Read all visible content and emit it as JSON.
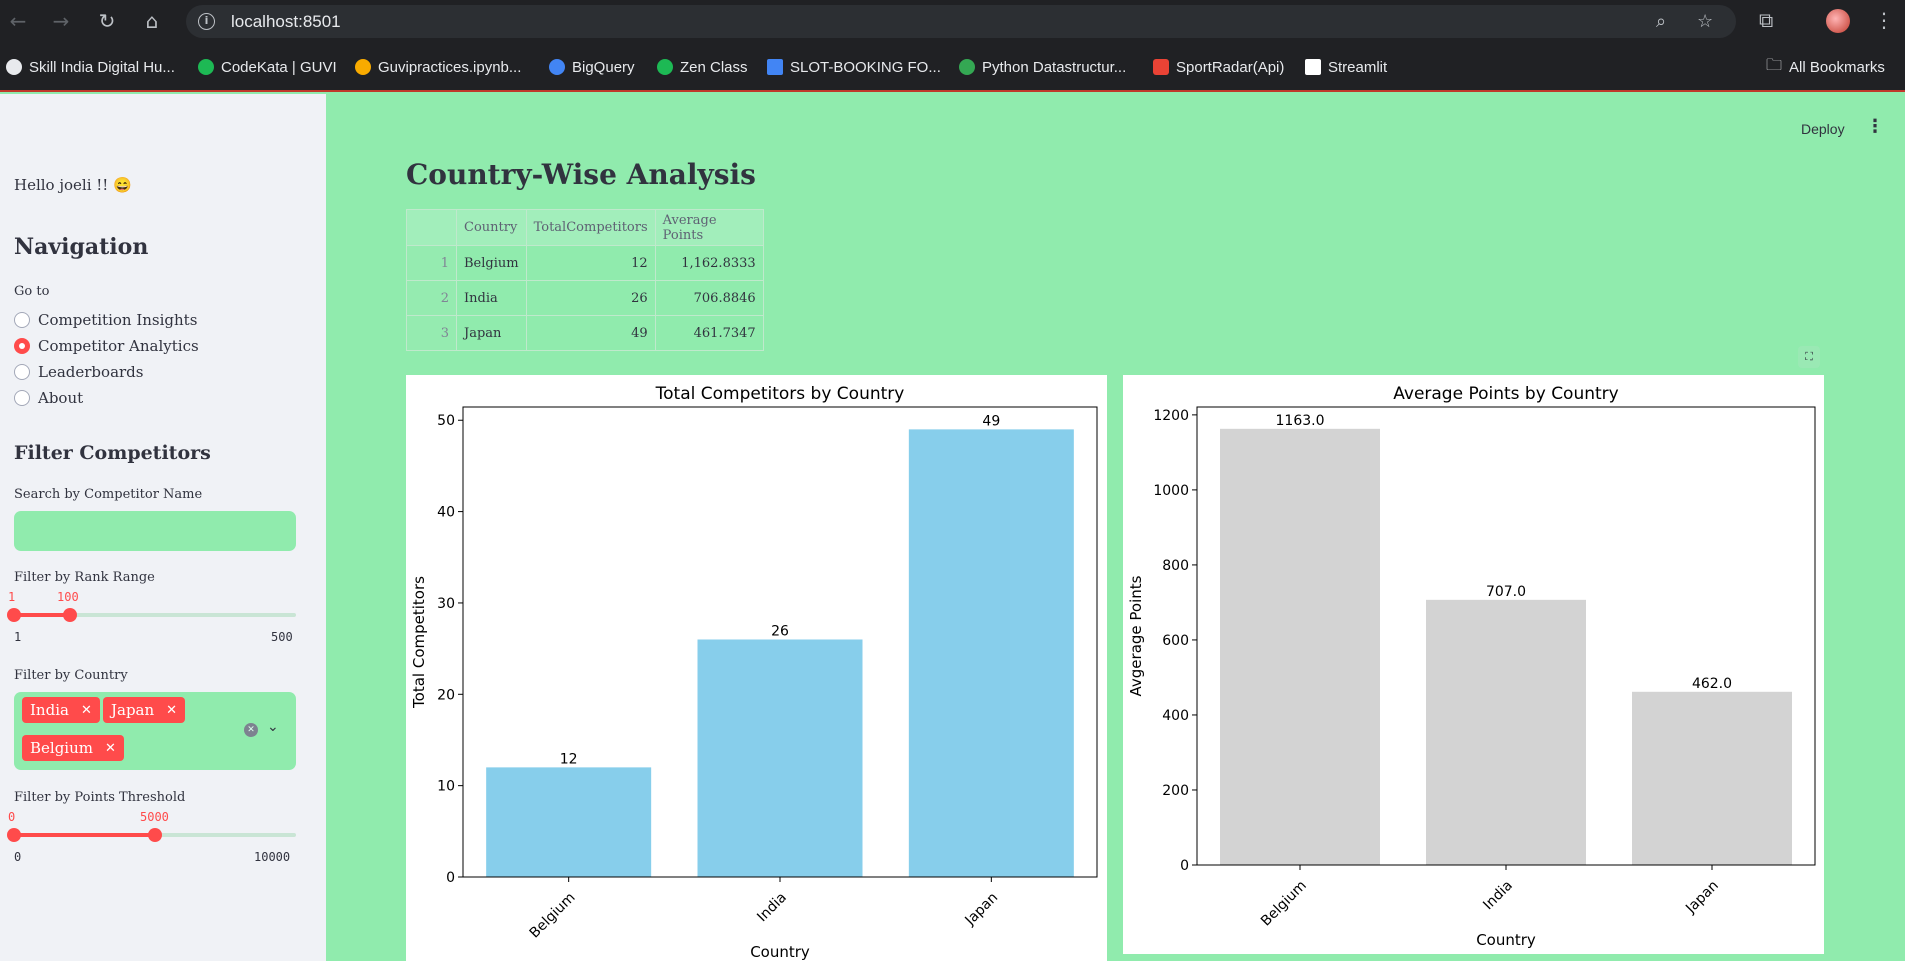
{
  "browser": {
    "url": "localhost:8501",
    "bookmarks": [
      {
        "label": "Skill India Digital Hu...",
        "color": "#e8eaed"
      },
      {
        "label": "CodeKata | GUVI",
        "color": "#1db954"
      },
      {
        "label": "Guvipractices.ipynb...",
        "color": "#f9ab00"
      },
      {
        "label": "BigQuery",
        "color": "#4285f4"
      },
      {
        "label": "Zen Class",
        "color": "#1db954"
      },
      {
        "label": "SLOT-BOOKING FO...",
        "color": "#4285f4"
      },
      {
        "label": "Python Datastructur...",
        "color": "#34a853"
      },
      {
        "label": "SportRadar(Api)",
        "color": "#ea4335"
      },
      {
        "label": "Streamlit",
        "color": "#ffffff"
      }
    ],
    "all_bookmarks": "All Bookmarks"
  },
  "sidebar": {
    "greeting": "Hello joeli !! 😄",
    "nav_heading": "Navigation",
    "goto_label": "Go to",
    "options": [
      {
        "label": "Competition Insights",
        "selected": false
      },
      {
        "label": "Competitor Analytics",
        "selected": true
      },
      {
        "label": "Leaderboards",
        "selected": false
      },
      {
        "label": "About",
        "selected": false
      }
    ],
    "filter_heading": "Filter Competitors",
    "search_label": "Search by Competitor Name",
    "search_value": "",
    "rank_label": "Filter by Rank Range",
    "rank": {
      "low": "1",
      "high": "100",
      "min": "1",
      "max": "500"
    },
    "country_label": "Filter by Country",
    "countries": [
      "India",
      "Japan",
      "Belgium"
    ],
    "points_label": "Filter by Points Threshold",
    "points": {
      "low": "0",
      "high": "5000",
      "min": "0",
      "max": "10000"
    }
  },
  "header": {
    "deploy": "Deploy"
  },
  "main": {
    "title": "Country-Wise Analysis",
    "table": {
      "columns": [
        "",
        "Country",
        "TotalCompetitors",
        "Average Points"
      ],
      "rows": [
        [
          "1",
          "Belgium",
          "12",
          "1,162.8333"
        ],
        [
          "2",
          "India",
          "26",
          "706.8846"
        ],
        [
          "3",
          "Japan",
          "49",
          "461.7347"
        ]
      ]
    }
  },
  "chart_data": [
    {
      "type": "bar",
      "title": "Total Competitors by Country",
      "xlabel": "Country",
      "ylabel": "Total Competitors",
      "categories": [
        "Belgium",
        "India",
        "Japan"
      ],
      "values": [
        12,
        26,
        49
      ],
      "labels": [
        "12",
        "26",
        "49"
      ],
      "ylim": [
        0,
        51.45
      ],
      "yticks": [
        0,
        10,
        20,
        30,
        40,
        50
      ],
      "color": "#87CEEB",
      "grid": false
    },
    {
      "type": "bar",
      "title": "Average Points by Country",
      "xlabel": "Country",
      "ylabel": "Avgerage Points",
      "categories": [
        "Belgium",
        "India",
        "Japan"
      ],
      "values": [
        1162.8333,
        706.8846,
        461.7347
      ],
      "labels": [
        "1163.0",
        "707.0",
        "462.0"
      ],
      "ylim": [
        0,
        1221
      ],
      "yticks": [
        0,
        200,
        400,
        600,
        800,
        1000,
        1200
      ],
      "color": "#D3D3D3",
      "grid": false
    }
  ]
}
